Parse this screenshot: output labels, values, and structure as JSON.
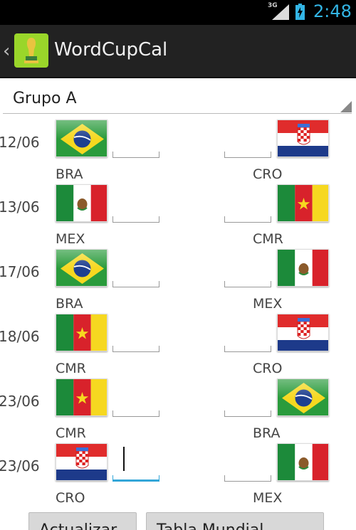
{
  "status_bar": {
    "network": "3G",
    "time": "2:48"
  },
  "action_bar": {
    "title": "WordCupCal",
    "back_icon": "chevron-left-icon",
    "logo_icon": "world-cup-logo-icon"
  },
  "group_selector": {
    "selected": "Grupo A"
  },
  "matches": [
    {
      "date": "12/06",
      "home": "BRA",
      "away": "CRO",
      "home_score": "",
      "away_score": ""
    },
    {
      "date": "13/06",
      "home": "MEX",
      "away": "CMR",
      "home_score": "",
      "away_score": ""
    },
    {
      "date": "17/06",
      "home": "BRA",
      "away": "MEX",
      "home_score": "",
      "away_score": ""
    },
    {
      "date": "18/06",
      "home": "CMR",
      "away": "CRO",
      "home_score": "",
      "away_score": ""
    },
    {
      "date": "23/06",
      "home": "CMR",
      "away": "BRA",
      "home_score": "",
      "away_score": ""
    },
    {
      "date": "23/06",
      "home": "CRO",
      "away": "MEX",
      "home_score": "",
      "away_score": ""
    }
  ],
  "buttons": {
    "update": "Actualizar",
    "table": "Tabla Mundial"
  },
  "colors": {
    "accent": "#33b5e5",
    "action_bar": "#222222",
    "status_bar": "#000000"
  }
}
